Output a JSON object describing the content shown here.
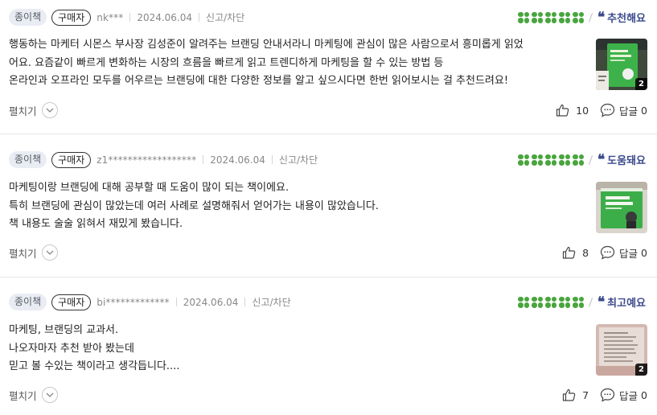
{
  "colors": {
    "accent": "#3d4b8e",
    "clover": "#49a53e",
    "badge_bg": "#e9ecf3"
  },
  "labels": {
    "book_type": "종이책",
    "buyer": "구매자",
    "report": "신고/차단",
    "expand": "펼치기",
    "reply_prefix": "답글"
  },
  "reviews": [
    {
      "user": "nk***",
      "date": "2024.06.04",
      "clovers": 5,
      "rating_label": "추천해요",
      "lines": [
        "행동하는 마케터 시몬스 부사장 김성준이 알려주는 브랜딩 안내서라니 마케팅에 관심이 많은 사람으로서 흥미롭게 읽었",
        "어요. 요즘같이 빠르게 변화하는 시장의 흐름을 빠르게 읽고 트렌디하게 마케팅을 할 수 있는 방법 등",
        "온라인과 오프라인 모두를 어우르는 브랜딩에 대한 다양한 정보를 알고 싶으시다면 한번 읽어보시는 걸 추천드려요!"
      ],
      "photo_count": "2",
      "likes": "10",
      "replies": "0"
    },
    {
      "user": "z1******************",
      "date": "2024.06.04",
      "clovers": 5,
      "rating_label": "도움돼요",
      "lines": [
        "마케팅이랑 브랜딩에 대해 공부할 때 도움이 많이 되는 책이에요.",
        "특히 브랜딩에 관심이 많았는데 여러 사례로 설명해줘서 얻어가는 내용이 많았습니다.",
        "책 내용도 술술 읽혀서 재밌게 봤습니다."
      ],
      "photo_count": "",
      "likes": "8",
      "replies": "0"
    },
    {
      "user": "bi*************",
      "date": "2024.06.04",
      "clovers": 5,
      "rating_label": "최고예요",
      "lines": [
        "마케팅, 브랜딩의 교과서.",
        "나오자마자 추천 받아 봤는데",
        "믿고 볼 수있는 책이라고 생각듭니다...."
      ],
      "photo_count": "2",
      "likes": "7",
      "replies": "0"
    }
  ]
}
